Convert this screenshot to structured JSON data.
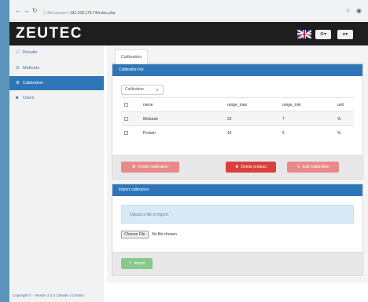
{
  "browser": {
    "back_icon": "arrow-left",
    "forward_icon": "arrow-right",
    "reload_icon": "reload",
    "security_label": "Not secure",
    "url": "192.168.178.74/index.php"
  },
  "brand": "ZEUTEC",
  "sidebar": {
    "items": [
      {
        "label": "Results",
        "icon": "circle-info"
      },
      {
        "label": "Methods",
        "icon": "list"
      },
      {
        "label": "Calibration",
        "icon": "gear"
      },
      {
        "label": "Users",
        "icon": "user"
      }
    ]
  },
  "content": {
    "tab": "Calibration",
    "calibration_panel": {
      "title": "Calibration list",
      "dropdown": "Calibration",
      "columns": [
        "name",
        "range_max",
        "range_min",
        "unit"
      ],
      "rows": [
        {
          "name": "Moisture",
          "range_max": "22",
          "range_min": "7",
          "unit": "%"
        },
        {
          "name": "Protein",
          "range_max": "15",
          "range_min": "5",
          "unit": "%"
        }
      ],
      "buttons": {
        "delete_calibration": "Delete calibration",
        "delete_product": "Delete product",
        "edit_calibration": "Edit Calibration"
      }
    },
    "import_panel": {
      "title": "Import calibration",
      "info": "Upload a file to import.",
      "choose_file": "Choose File",
      "no_file": "No file chosen",
      "import_button": "Import"
    }
  },
  "footer": {
    "copyright": "Copyright © - Version 2.2.4 | ",
    "link_zeutec": "Zeutec",
    "separator": " | ",
    "link_contact": "Contact"
  },
  "colors": {
    "primary": "#2f76b8",
    "navbar": "#1e1e1e",
    "danger": "#d9403d",
    "success": "#86c98b"
  }
}
